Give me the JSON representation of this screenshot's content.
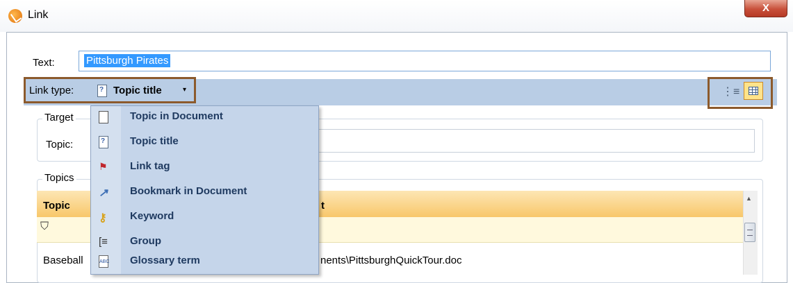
{
  "window": {
    "title": "Link",
    "close_glyph": "X"
  },
  "text_field": {
    "label": "Text:",
    "value": "Pittsburgh Pirates"
  },
  "link_type": {
    "label": "Link type:",
    "value": "Topic title",
    "caret": "▾"
  },
  "target_group": {
    "legend": "Target",
    "topic_label": "Topic:"
  },
  "topics_group": {
    "legend": "Topics",
    "columns": [
      "Topic",
      "t"
    ],
    "rows": [
      {
        "topic": "Baseball",
        "path": "nents\\PittsburghQuickTour.doc"
      }
    ]
  },
  "dropdown_items": [
    {
      "label": "Topic in Document",
      "icon": "page-icon"
    },
    {
      "label": "Topic title",
      "icon": "topic-title-icon"
    },
    {
      "label": "Link tag",
      "icon": "flag-icon"
    },
    {
      "label": "Bookmark in Document",
      "icon": "bookmark-icon"
    },
    {
      "label": "Keyword",
      "icon": "key-icon"
    },
    {
      "label": "Group",
      "icon": "group-icon"
    },
    {
      "label": "Glossary term",
      "icon": "glossary-icon"
    }
  ],
  "icons": {
    "filter": "⛉",
    "tree_view": "⋮≡",
    "scroll_up": "▲"
  },
  "colors": {
    "accent_border": "#8c5a2c",
    "toolbar_bg": "#b9cde5",
    "header_bg": "#f8c76a"
  }
}
